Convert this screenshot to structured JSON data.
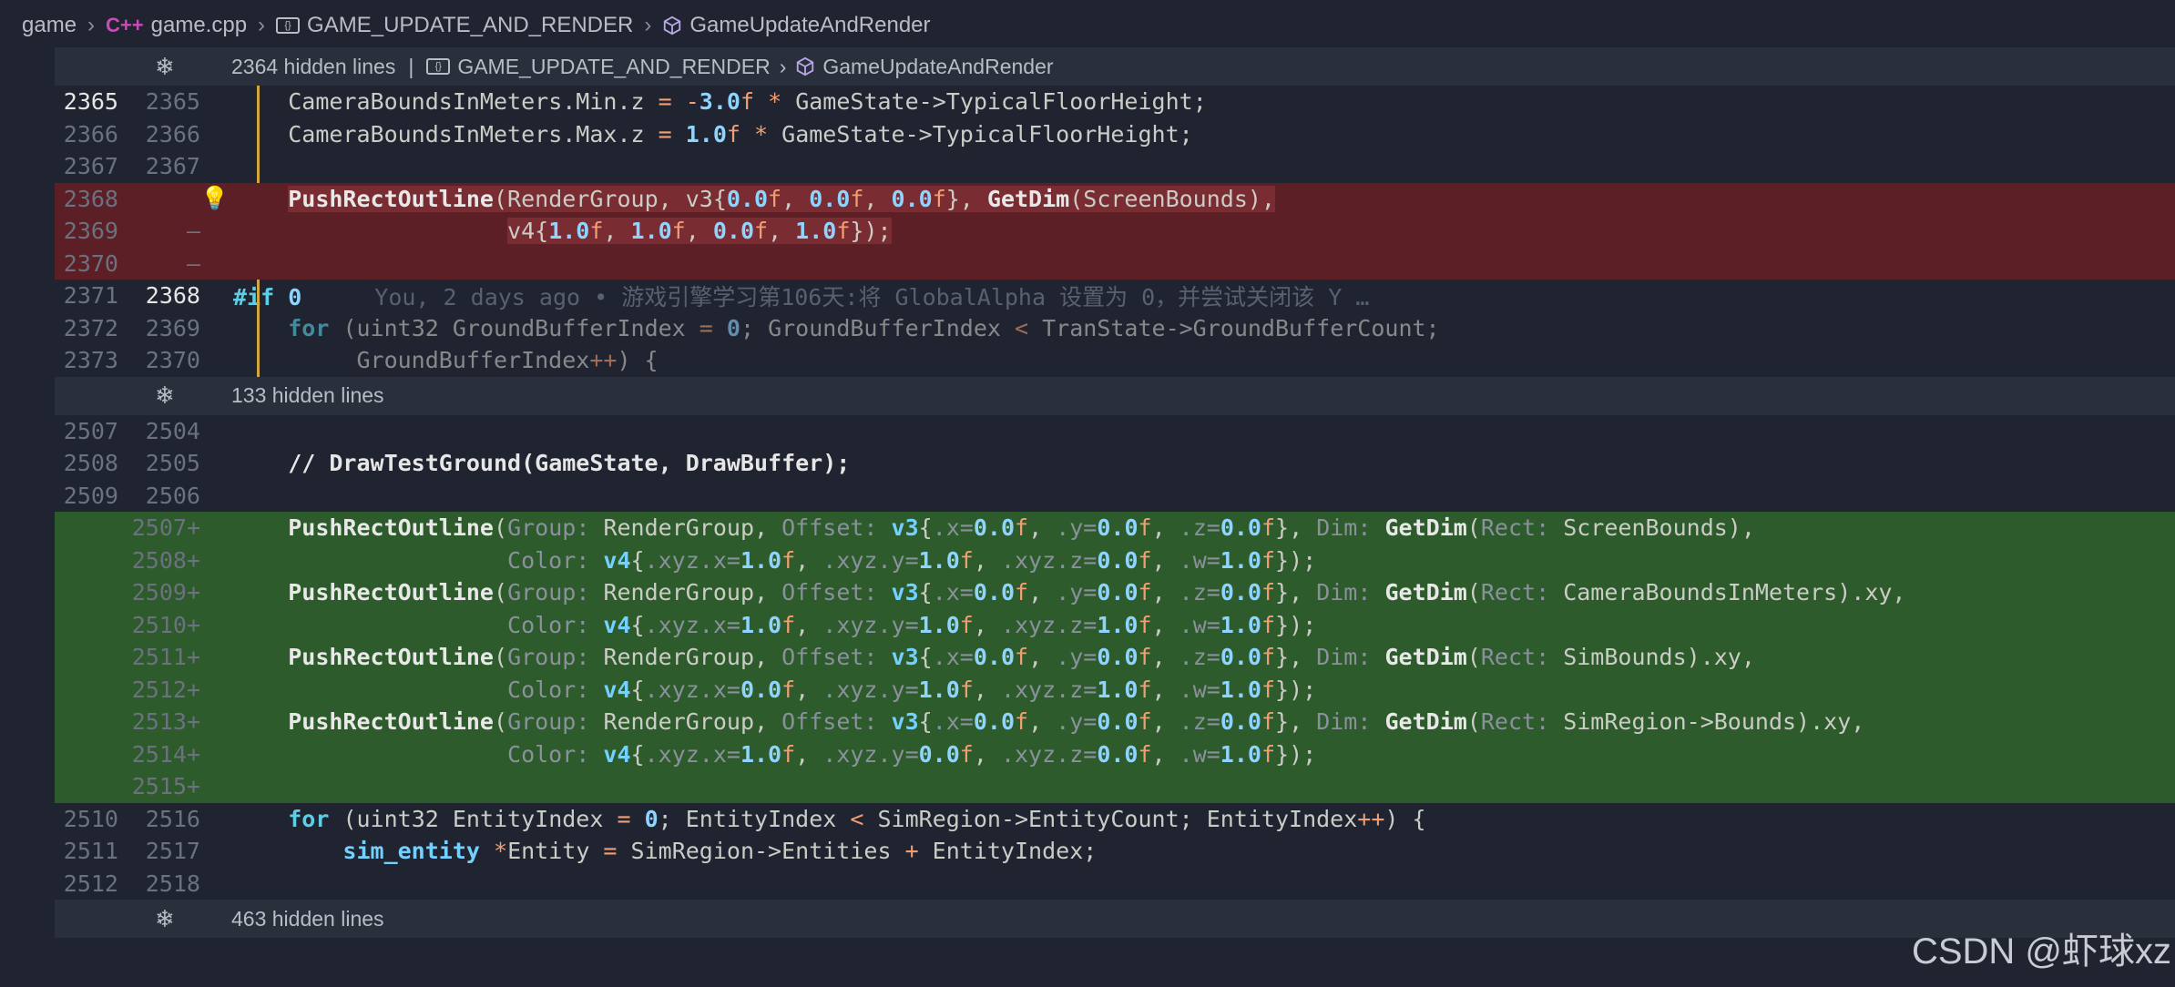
{
  "breadcrumb": {
    "items": [
      "game",
      "game.cpp",
      "GAME_UPDATE_AND_RENDER",
      "GameUpdateAndRender"
    ],
    "cpp_icon": "C++"
  },
  "folds": [
    {
      "text": "2364 hidden lines",
      "scope1": "GAME_UPDATE_AND_RENDER",
      "scope2": "GameUpdateAndRender"
    },
    {
      "text": "133 hidden lines"
    },
    {
      "text": "463 hidden lines"
    }
  ],
  "lines1": [
    {
      "l": "2365",
      "r": "2365"
    },
    {
      "l": "2366",
      "r": "2366"
    },
    {
      "l": "2367",
      "r": "2367"
    },
    {
      "l": "2368",
      "r": ""
    },
    {
      "l": "2369",
      "r": "—"
    },
    {
      "l": "2370",
      "r": "—"
    },
    {
      "l": "2371",
      "r": "2368"
    },
    {
      "l": "2372",
      "r": "2369"
    },
    {
      "l": "2373",
      "r": "2370"
    }
  ],
  "lines2": [
    {
      "l": "2507",
      "r": "2504"
    },
    {
      "l": "2508",
      "r": "2505"
    },
    {
      "l": "2509",
      "r": "2506"
    },
    {
      "l": "",
      "r": "2507+"
    },
    {
      "l": "",
      "r": "2508+"
    },
    {
      "l": "",
      "r": "2509+"
    },
    {
      "l": "",
      "r": "2510+"
    },
    {
      "l": "",
      "r": "2511+"
    },
    {
      "l": "",
      "r": "2512+"
    },
    {
      "l": "",
      "r": "2513+"
    },
    {
      "l": "",
      "r": "2514+"
    },
    {
      "l": "",
      "r": "2515+"
    },
    {
      "l": "2510",
      "r": "2516"
    },
    {
      "l": "2511",
      "r": "2517"
    },
    {
      "l": "2512",
      "r": "2518"
    }
  ],
  "blame": "You, 2 days ago • 游戏引擎学习第106天:将 GlobalAlpha 设置为 0，并尝试关闭该 Y …",
  "comment": "// DrawTestGround(GameState, DrawBuffer);",
  "watermark": "CSDN @虾球xz"
}
